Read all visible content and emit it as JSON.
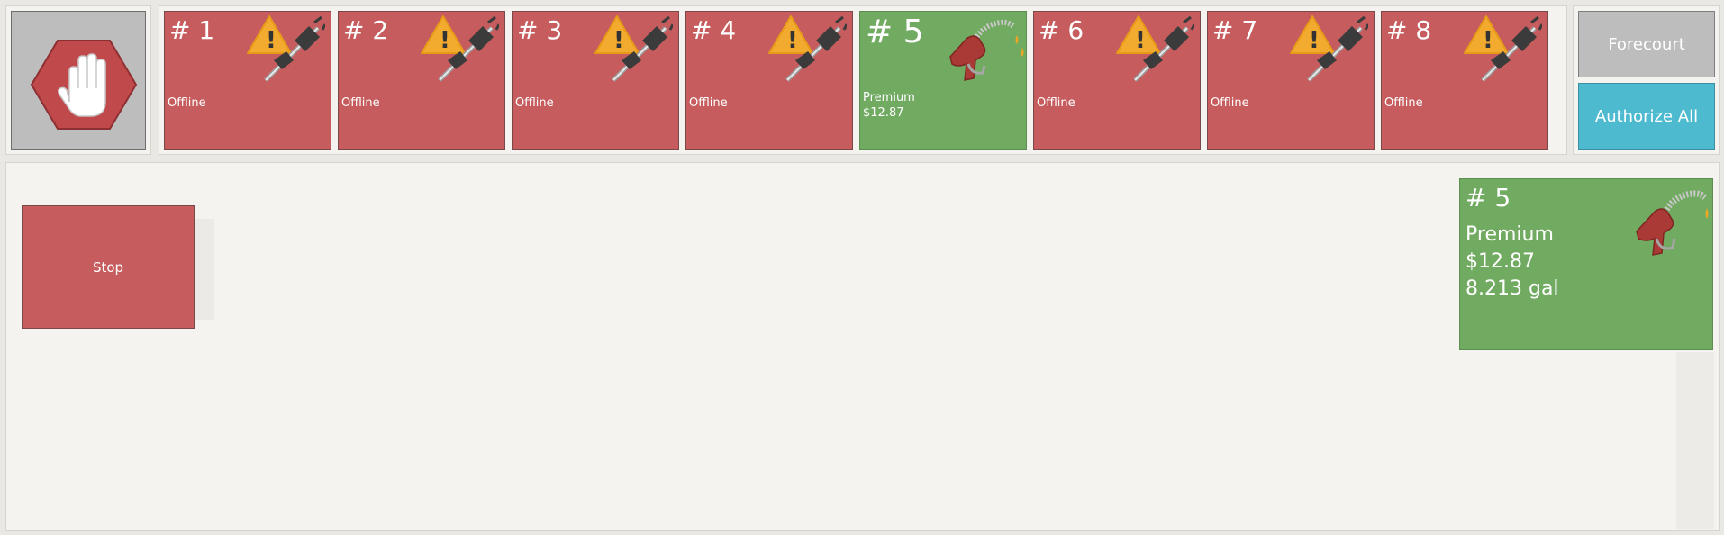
{
  "pumps": [
    {
      "number": "# 1",
      "state": "offline",
      "status": "Offline"
    },
    {
      "number": "# 2",
      "state": "offline",
      "status": "Offline"
    },
    {
      "number": "# 3",
      "state": "offline",
      "status": "Offline"
    },
    {
      "number": "# 4",
      "state": "offline",
      "status": "Offline"
    },
    {
      "number": "# 5",
      "state": "active",
      "grade": "Premium",
      "amount": "$12.87"
    },
    {
      "number": "# 6",
      "state": "offline",
      "status": "Offline"
    },
    {
      "number": "# 7",
      "state": "offline",
      "status": "Offline"
    },
    {
      "number": "# 8",
      "state": "offline",
      "status": "Offline"
    }
  ],
  "actions": {
    "forecourt_label": "Forecourt",
    "authorize_all_label": "Authorize All"
  },
  "detail": {
    "stop_label": "Stop",
    "selected": {
      "number": "# 5",
      "grade": "Premium",
      "amount": "$12.87",
      "volume": "8.213 gal"
    }
  },
  "colors": {
    "offline": "#c65c5d",
    "active": "#71aa61",
    "authorize": "#4dbad0",
    "neutral_button": "#bdbdbd"
  },
  "icons": {
    "stop_all": "stop-hand-icon",
    "offline": "warning-disconnected-plug-icon",
    "active": "fuel-nozzle-icon"
  }
}
